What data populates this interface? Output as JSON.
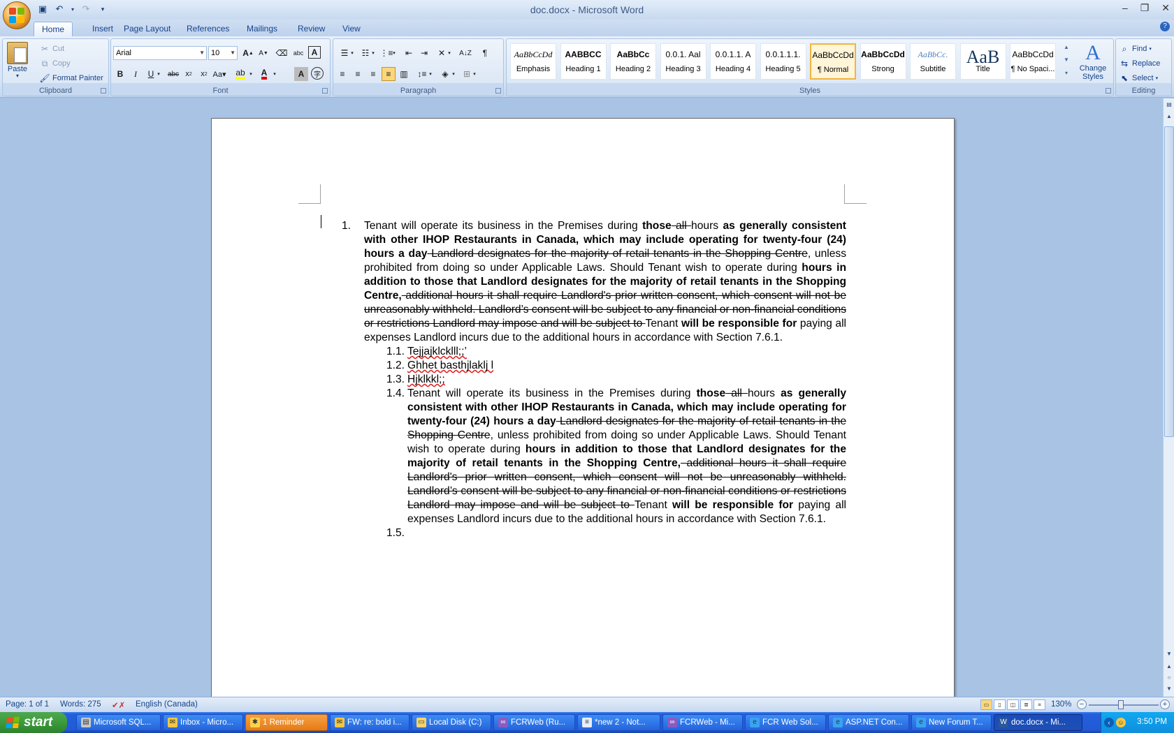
{
  "window": {
    "title": "doc.docx - Microsoft Word"
  },
  "qat": {
    "save_icon": "save-icon",
    "undo_icon": "undo-icon",
    "redo_icon": "redo-icon",
    "customize_icon": "customize-qat-icon"
  },
  "tabs": [
    {
      "label": "Home",
      "active": true
    },
    {
      "label": "Insert"
    },
    {
      "label": "Page Layout"
    },
    {
      "label": "References"
    },
    {
      "label": "Mailings"
    },
    {
      "label": "Review"
    },
    {
      "label": "View"
    }
  ],
  "clipboard": {
    "paste": "Paste",
    "cut": "Cut",
    "copy": "Copy",
    "format_painter": "Format Painter",
    "label": "Clipboard"
  },
  "font": {
    "name": "Arial",
    "size": "10",
    "label": "Font"
  },
  "paragraph": {
    "label": "Paragraph"
  },
  "styles": {
    "label": "Styles",
    "items": [
      {
        "preview": "AaBbCcDd",
        "name": "Emphasis"
      },
      {
        "preview": "AABBCC",
        "name": "Heading 1"
      },
      {
        "preview": "AaBbCc",
        "name": "Heading 2"
      },
      {
        "preview": "0.0.1.  Aal",
        "name": "Heading 3"
      },
      {
        "preview": "0.0.1.1.  A",
        "name": "Heading 4"
      },
      {
        "preview": "0.0.1.1.1.",
        "name": "Heading 5"
      },
      {
        "preview": "AaBbCcDd",
        "name": "¶ Normal",
        "selected": true
      },
      {
        "preview": "AaBbCcDd",
        "name": "Strong"
      },
      {
        "preview": "AaBbCc.",
        "name": "Subtitle"
      },
      {
        "preview": "AaB",
        "name": "Title"
      },
      {
        "preview": "AaBbCcDd",
        "name": "¶ No Spaci..."
      }
    ],
    "change_styles": "Change Styles"
  },
  "editing": {
    "find": "Find",
    "replace": "Replace",
    "select": "Select",
    "label": "Editing"
  },
  "document": {
    "p1_num": "1.",
    "p1": {
      "t1": "Tenant will operate its business in the Premises during ",
      "b1": "those",
      "s1": " all ",
      "t2": "hours ",
      "b2": "as generally consistent with other IHOP Restaurants in Canada, which may include operating for twenty-four (24) hours a day",
      "s2": " Landlord designates for the majority of retail tenants in the Shopping Centre",
      "t3": ", unless prohibited from doing so under Applicable Laws.  Should Tenant wish to operate during ",
      "b3": "hours in addition to those that Landlord designates for the majority of retail tenants in the Shopping Centre",
      "t4": ",",
      "s3": " additional hours it shall require Landlord's prior written consent, which consent will not be unreasonably withheld.  Landlord’s consent will be subject to any financial or non-financial conditions or restrictions Landlord may impose and will be subject to ",
      "t5": "Tenant ",
      "b4": "will be responsible for",
      "t6": " paying all expenses Landlord incurs due to the additional hours in accordance with Section 7.6.1."
    },
    "sub": [
      {
        "num": "1.1.",
        "text": "Tejjajklcklll;;’"
      },
      {
        "num": "1.2.",
        "text": "Ghhet basthjlaklj l"
      },
      {
        "num": "1.3.",
        "text": "Hjklkkl;;"
      }
    ],
    "p14_num": "1.4.",
    "p15_num": "1.5."
  },
  "statusbar": {
    "page": "Page: 1 of 1",
    "words": "Words: 275",
    "language": "English (Canada)",
    "zoom": "130%",
    "zoom_level": 0.46
  },
  "taskbar": {
    "start": "start",
    "tasks": [
      {
        "label": "Microsoft SQL...",
        "icon": "sql-server-icon"
      },
      {
        "label": "Inbox - Micro...",
        "icon": "outlook-icon"
      },
      {
        "label": "1 Reminder",
        "icon": "reminder-icon",
        "highlight": true
      },
      {
        "label": "FW: re: bold i...",
        "icon": "mail-icon"
      },
      {
        "label": "Local Disk (C:)",
        "icon": "folder-icon"
      },
      {
        "label": "FCRWeb (Ru...",
        "icon": "visual-studio-icon"
      },
      {
        "label": "*new  2 - Not...",
        "icon": "notepad-icon"
      },
      {
        "label": "FCRWeb - Mi...",
        "icon": "visual-studio-icon"
      },
      {
        "label": "FCR Web Sol...",
        "icon": "ie-icon"
      },
      {
        "label": "ASP.NET Con...",
        "icon": "ie-icon"
      },
      {
        "label": "New Forum T...",
        "icon": "ie-icon"
      },
      {
        "label": "doc.docx - Mi...",
        "icon": "word-icon",
        "active": true
      }
    ],
    "clock": "3:50 PM"
  }
}
